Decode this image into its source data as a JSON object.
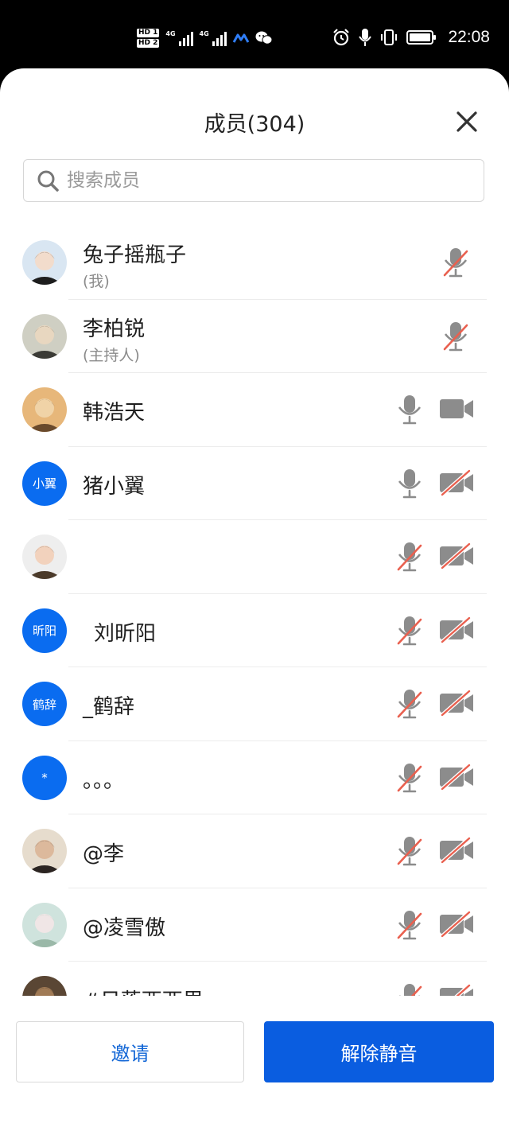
{
  "status_bar": {
    "time": "22:08",
    "sim1_label": "HD 1",
    "sim2_label": "HD 2",
    "network1": "4G",
    "network2": "4G",
    "icons": [
      "hd-icon",
      "signal-icon",
      "signal-icon",
      "meeting-app-icon",
      "wechat-icon",
      "alarm-icon",
      "mic-icon",
      "vibrate-icon",
      "battery-icon"
    ]
  },
  "panel": {
    "title": "成员(304)",
    "search_placeholder": "搜索成员",
    "search_value": ""
  },
  "members": [
    {
      "name": "兔子摇瓶子",
      "role": "(我)",
      "avatar": "photo",
      "mic": "muted",
      "cam": "none"
    },
    {
      "name": "李柏锐",
      "role": "(主持人)",
      "avatar": "photo",
      "mic": "muted",
      "cam": "none"
    },
    {
      "name": "韩浩天",
      "role": "",
      "avatar": "photo",
      "mic": "on",
      "cam": "on"
    },
    {
      "name": "猪小翼",
      "role": "",
      "avatar_text": "小翼",
      "mic": "on",
      "cam": "off"
    },
    {
      "name": "",
      "role": "",
      "avatar": "photo",
      "mic": "muted",
      "cam": "off"
    },
    {
      "name": "刘昕阳",
      "role": "",
      "avatar_text": "昕阳",
      "mic": "muted",
      "cam": "off"
    },
    {
      "name": "_鹤辞",
      "role": "",
      "avatar_text": "鹤辞",
      "mic": "muted",
      "cam": "off"
    },
    {
      "name": "。。。",
      "role": "",
      "avatar_text": "*",
      "mic": "muted",
      "cam": "off"
    },
    {
      "name": "@李",
      "role": "",
      "avatar": "photo",
      "mic": "muted",
      "cam": "off"
    },
    {
      "name": "@凌雪傲",
      "role": "",
      "avatar": "photo",
      "mic": "muted",
      "cam": "off"
    },
    {
      "name": "#日落西西里",
      "role": "",
      "avatar": "photo",
      "mic": "muted",
      "cam": "off"
    }
  ],
  "buttons": {
    "invite": "邀请",
    "unmute_all": "解除静音"
  },
  "colors": {
    "accent": "#0a5de0",
    "avatar_blue": "#0a6cf0",
    "muted_slash": "#e9604f",
    "icon_gray": "#8c8c8c"
  }
}
